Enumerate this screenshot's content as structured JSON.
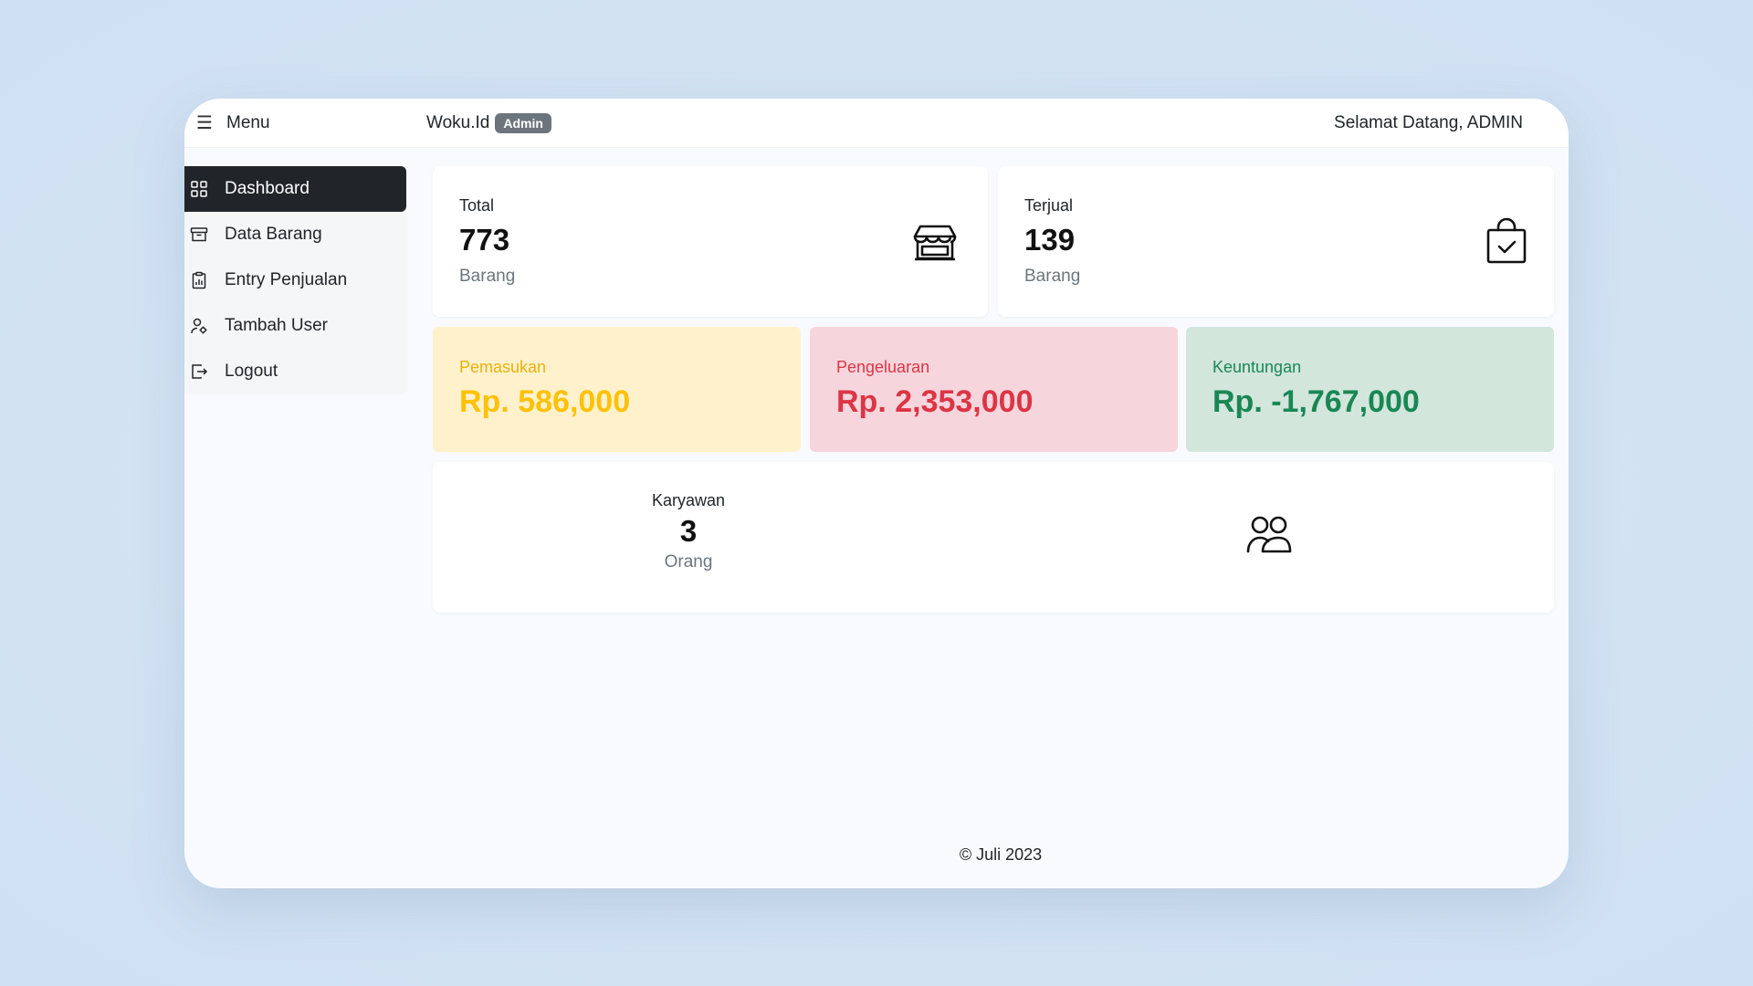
{
  "topbar": {
    "menu_label": "Menu",
    "brand_name": "Woku.Id",
    "brand_badge": "Admin",
    "greeting": "Selamat Datang, ADMIN"
  },
  "sidebar": {
    "items": [
      {
        "label": "Dashboard",
        "icon": "grid-icon",
        "active": true
      },
      {
        "label": "Data Barang",
        "icon": "archive-icon",
        "active": false
      },
      {
        "label": "Entry Penjualan",
        "icon": "clipboard-data-icon",
        "active": false
      },
      {
        "label": "Tambah User",
        "icon": "person-gear-icon",
        "active": false
      },
      {
        "label": "Logout",
        "icon": "box-arrow-right-icon",
        "active": false
      }
    ]
  },
  "stats": {
    "total": {
      "label": "Total",
      "value": "773",
      "unit": "Barang",
      "icon": "shop-icon"
    },
    "terjual": {
      "label": "Terjual",
      "value": "139",
      "unit": "Barang",
      "icon": "bag-check-icon"
    },
    "karyawan": {
      "label": "Karyawan",
      "value": "3",
      "unit": "Orang",
      "icon": "people-icon"
    }
  },
  "finance": {
    "pemasukan": {
      "label": "Pemasukan",
      "value": "Rp. 586,000",
      "color": "#ffc107",
      "bg": "#fff1cc"
    },
    "pengeluaran": {
      "label": "Pengeluaran",
      "value": "Rp. 2,353,000",
      "color": "#dc3545",
      "bg": "#f6d6dc"
    },
    "keuntungan": {
      "label": "Keuntungan",
      "value": "Rp. -1,767,000",
      "color": "#198754",
      "bg": "#d2e6dc"
    }
  },
  "footer": {
    "text": "© Juli 2023"
  }
}
